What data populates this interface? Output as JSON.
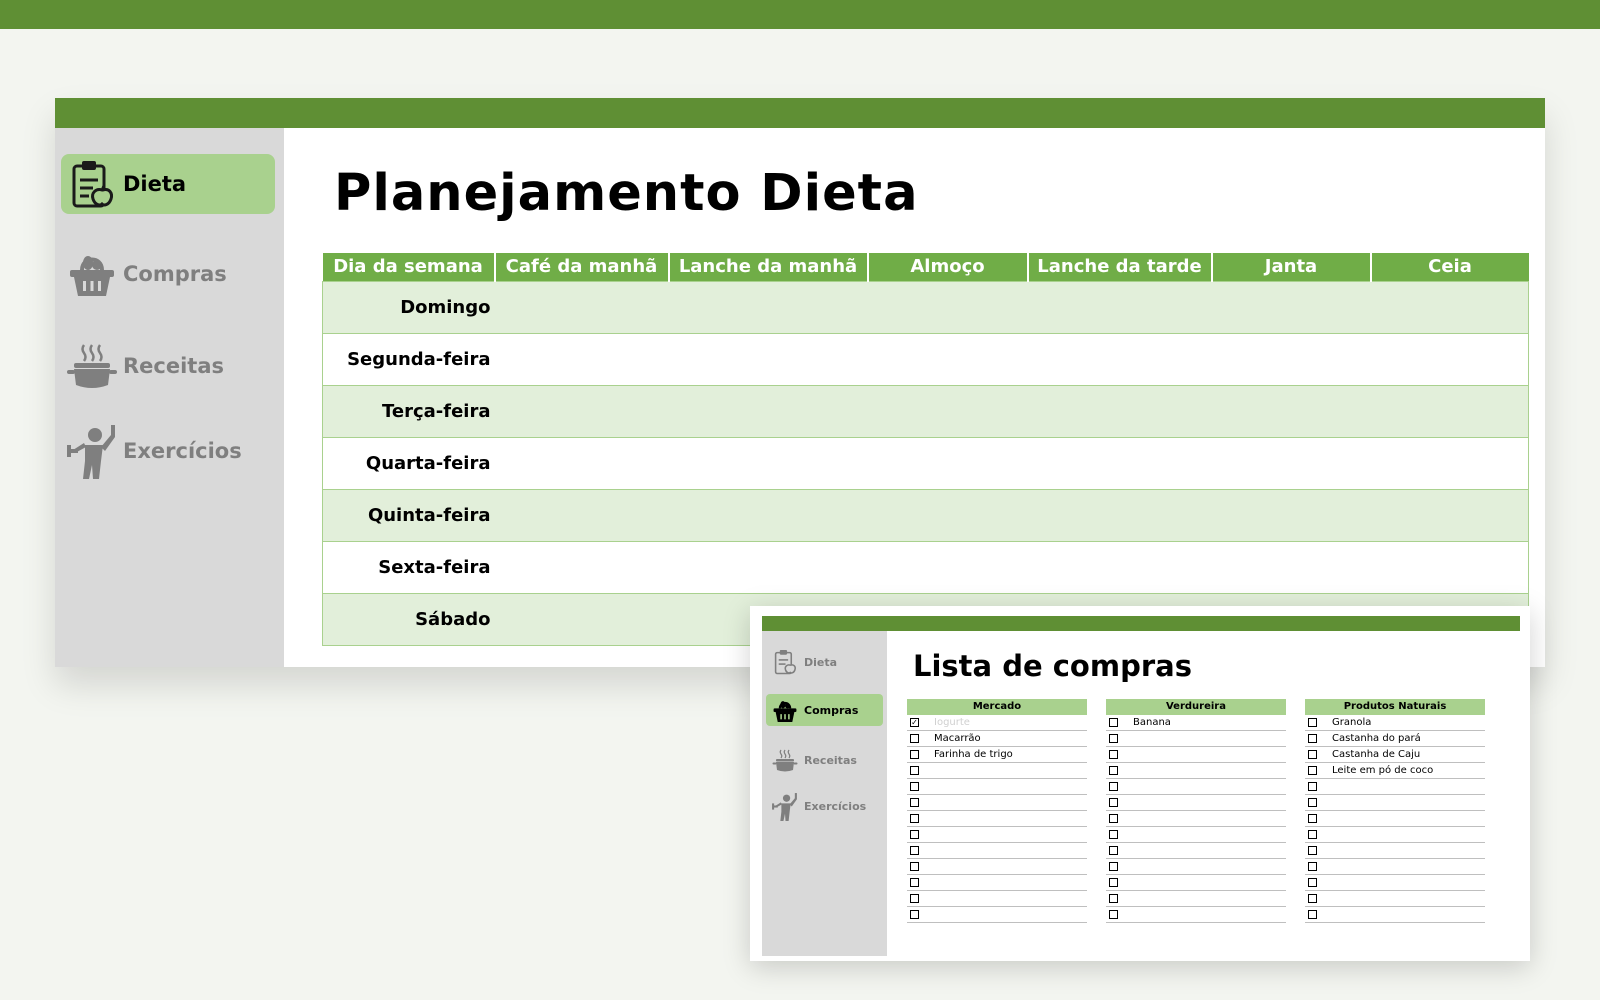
{
  "colors": {
    "brand_green": "#5f8f34",
    "header_green": "#70ad47",
    "light_green": "#a9d18e",
    "row_green": "#e2efda",
    "sidebar_gray": "#d9d9d9"
  },
  "main_window": {
    "title": "Planejamento Dieta",
    "nav": [
      {
        "label": "Dieta",
        "icon": "clipboard-apple-icon",
        "active": true
      },
      {
        "label": "Compras",
        "icon": "shopping-basket-icon",
        "active": false
      },
      {
        "label": "Receitas",
        "icon": "cooking-pot-icon",
        "active": false
      },
      {
        "label": "Exercícios",
        "icon": "person-exercise-icon",
        "active": false
      }
    ],
    "table": {
      "headers": [
        "Dia da semana",
        "Café da manhã",
        "Lanche da manhã",
        "Almoço",
        "Lanche da tarde",
        "Janta",
        "Ceia"
      ],
      "days": [
        "Domingo",
        "Segunda-feira",
        "Terça-feira",
        "Quarta-feira",
        "Quinta-feira",
        "Sexta-feira",
        "Sábado"
      ]
    }
  },
  "shopping_window": {
    "title": "Lista de compras",
    "nav": [
      {
        "label": "Dieta",
        "icon": "clipboard-apple-icon",
        "active": false
      },
      {
        "label": "Compras",
        "icon": "shopping-basket-icon",
        "active": true
      },
      {
        "label": "Receitas",
        "icon": "cooking-pot-icon",
        "active": false
      },
      {
        "label": "Exercícios",
        "icon": "person-exercise-icon",
        "active": false
      }
    ],
    "columns": [
      {
        "header": "Mercado",
        "items": [
          {
            "text": "Iogurte",
            "checked": true
          },
          {
            "text": "Macarrão",
            "checked": false
          },
          {
            "text": "Farinha de trigo",
            "checked": false
          },
          {
            "text": "",
            "checked": false
          },
          {
            "text": "",
            "checked": false
          },
          {
            "text": "",
            "checked": false
          },
          {
            "text": "",
            "checked": false
          },
          {
            "text": "",
            "checked": false
          },
          {
            "text": "",
            "checked": false
          },
          {
            "text": "",
            "checked": false
          },
          {
            "text": "",
            "checked": false
          },
          {
            "text": "",
            "checked": false
          },
          {
            "text": "",
            "checked": false
          }
        ]
      },
      {
        "header": "Verdureira",
        "items": [
          {
            "text": "Banana",
            "checked": false
          },
          {
            "text": "",
            "checked": false
          },
          {
            "text": "",
            "checked": false
          },
          {
            "text": "",
            "checked": false
          },
          {
            "text": "",
            "checked": false
          },
          {
            "text": "",
            "checked": false
          },
          {
            "text": "",
            "checked": false
          },
          {
            "text": "",
            "checked": false
          },
          {
            "text": "",
            "checked": false
          },
          {
            "text": "",
            "checked": false
          },
          {
            "text": "",
            "checked": false
          },
          {
            "text": "",
            "checked": false
          },
          {
            "text": "",
            "checked": false
          }
        ]
      },
      {
        "header": "Produtos Naturais",
        "items": [
          {
            "text": "Granola",
            "checked": false
          },
          {
            "text": "Castanha do pará",
            "checked": false
          },
          {
            "text": "Castanha de Caju",
            "checked": false
          },
          {
            "text": "Leite em pó de coco",
            "checked": false
          },
          {
            "text": "",
            "checked": false
          },
          {
            "text": "",
            "checked": false
          },
          {
            "text": "",
            "checked": false
          },
          {
            "text": "",
            "checked": false
          },
          {
            "text": "",
            "checked": false
          },
          {
            "text": "",
            "checked": false
          },
          {
            "text": "",
            "checked": false
          },
          {
            "text": "",
            "checked": false
          },
          {
            "text": "",
            "checked": false
          }
        ]
      }
    ]
  }
}
